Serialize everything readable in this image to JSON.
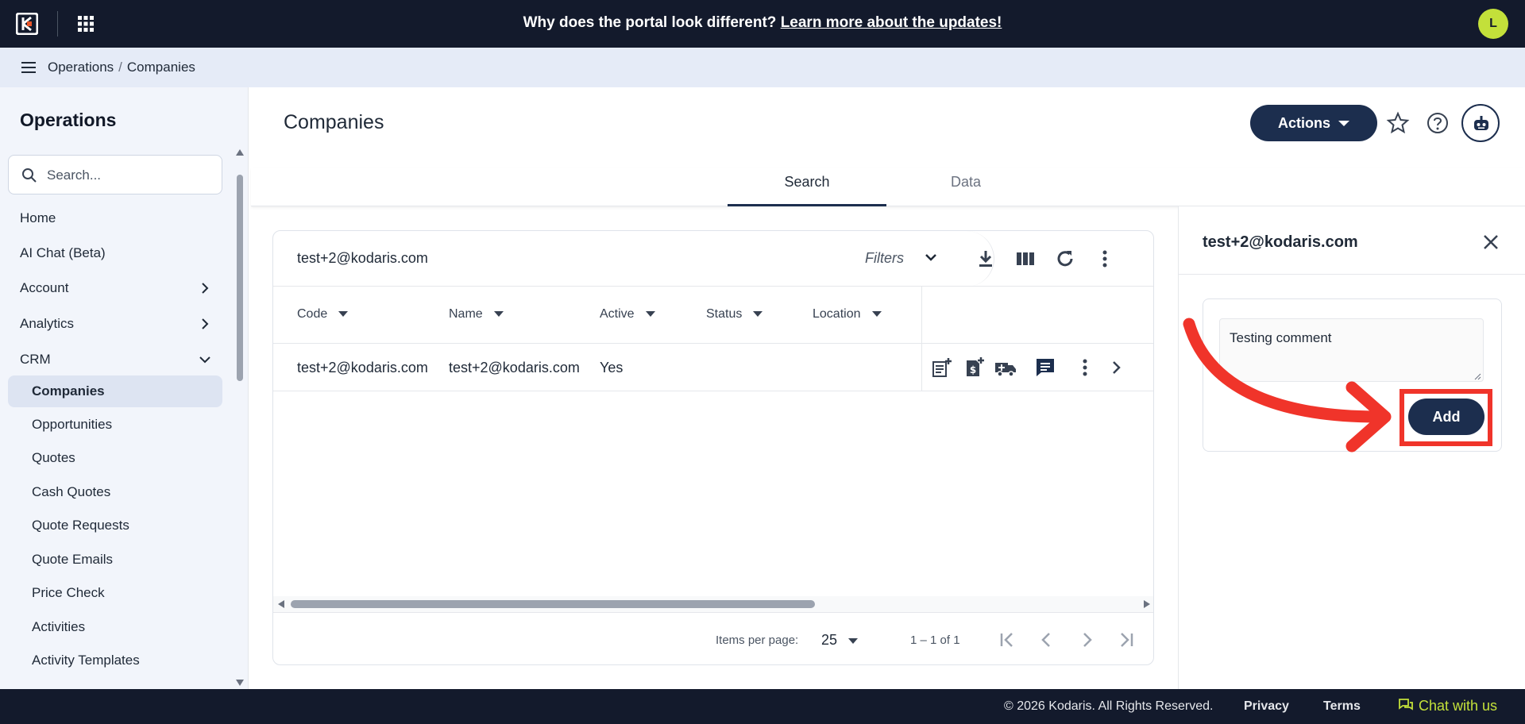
{
  "banner": {
    "question": "Why does the portal look different?",
    "link": "Learn more about the updates!"
  },
  "user": {
    "initial": "L"
  },
  "breadcrumb": {
    "section": "Operations",
    "separator": "/",
    "page": "Companies"
  },
  "sidebar": {
    "title": "Operations",
    "search_placeholder": "Search...",
    "items": [
      {
        "label": "Home"
      },
      {
        "label": "AI Chat (Beta)"
      },
      {
        "label": "Account"
      },
      {
        "label": "Analytics"
      },
      {
        "label": "CRM"
      },
      {
        "label": "Companies"
      },
      {
        "label": "Opportunities"
      },
      {
        "label": "Quotes"
      },
      {
        "label": "Cash Quotes"
      },
      {
        "label": "Quote Requests"
      },
      {
        "label": "Quote Emails"
      },
      {
        "label": "Price Check"
      },
      {
        "label": "Activities"
      },
      {
        "label": "Activity Templates"
      }
    ]
  },
  "main": {
    "title": "Companies",
    "actions_label": "Actions",
    "tabs": [
      {
        "label": "Search"
      },
      {
        "label": "Data"
      }
    ]
  },
  "table": {
    "search_term": "test+2@kodaris.com",
    "filters_label": "Filters",
    "columns": [
      "Code",
      "Name",
      "Active",
      "Status",
      "Location"
    ],
    "rows": [
      {
        "code": "test+2@kodaris.com",
        "name": "test+2@kodaris.com",
        "active": "Yes",
        "status": "",
        "location": ""
      }
    ],
    "paginator": {
      "items_per_page_label": "Items per page:",
      "page_size": "25",
      "range": "1 – 1 of 1"
    }
  },
  "detail": {
    "title": "test+2@kodaris.com",
    "comment": "Testing comment",
    "add_label": "Add"
  },
  "footer": {
    "copyright": "© 2026 Kodaris. All Rights Reserved.",
    "privacy": "Privacy",
    "terms": "Terms",
    "chat": "Chat with us"
  },
  "colors": {
    "navy": "#131a2c",
    "button": "#1c2e4e",
    "accent_lime": "#c3e03a",
    "annotation_red": "#f0342a"
  }
}
